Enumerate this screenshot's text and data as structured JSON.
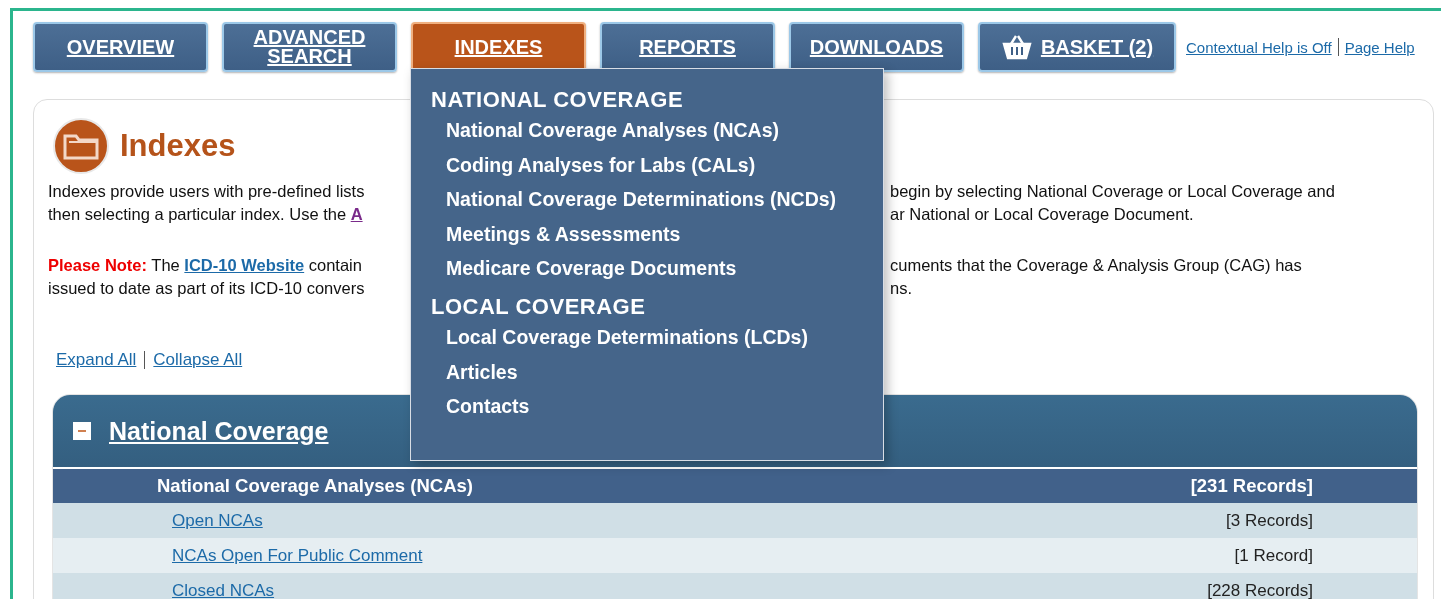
{
  "nav": {
    "tabs": [
      {
        "label": "OVERVIEW",
        "selected": false,
        "kind": "text"
      },
      {
        "label": "ADVANCED SEARCH",
        "selected": false,
        "kind": "text"
      },
      {
        "label": "INDEXES",
        "selected": true,
        "kind": "text"
      },
      {
        "label": "REPORTS",
        "selected": false,
        "kind": "text"
      },
      {
        "label": "DOWNLOADS",
        "selected": false,
        "kind": "text"
      },
      {
        "label": "BASKET (2)",
        "selected": false,
        "kind": "basket"
      }
    ],
    "help_links": [
      "Contextual Help is Off",
      "Page Help"
    ]
  },
  "dropdown": {
    "groups": [
      {
        "heading": "NATIONAL COVERAGE",
        "items": [
          "National Coverage Analyses (NCAs)",
          "Coding Analyses for Labs (CALs)",
          "National Coverage Determinations (NCDs)",
          "Meetings & Assessments",
          "Medicare Coverage Documents"
        ]
      },
      {
        "heading": "LOCAL COVERAGE",
        "items": [
          "Local Coverage Determinations (LCDs)",
          "Articles",
          "Contacts"
        ]
      }
    ]
  },
  "page": {
    "title": "Indexes",
    "paragraphs": [
      {
        "lines": [
          {
            "segments": [
              {
                "kind": "plain",
                "text": "Indexes provide users with pre-defined lists"
              }
            ],
            "right": "begin by selecting National Coverage or Local Coverage and"
          },
          {
            "segments": [
              {
                "kind": "plain",
                "text": "then selecting a particular index. Use the "
              },
              {
                "kind": "visited-link",
                "text": "A"
              }
            ],
            "right": "ar National or Local Coverage Document."
          }
        ]
      },
      {
        "lines": [
          {
            "segments": [
              {
                "kind": "note-label",
                "text": "Please Note:"
              },
              {
                "kind": "plain",
                "text": " The "
              },
              {
                "kind": "link",
                "text": "ICD-10 Website"
              },
              {
                "kind": "plain",
                "text": " contain"
              }
            ],
            "right": "cuments that the Coverage & Analysis Group (CAG) has"
          },
          {
            "segments": [
              {
                "kind": "plain",
                "text": "issued to date as part of its ICD-10 convers"
              }
            ],
            "right": "ns."
          }
        ]
      }
    ],
    "toggle_links": [
      "Expand All",
      "Collapse All"
    ],
    "section": {
      "title": "National Coverage",
      "expanded": true,
      "group": {
        "heading": "National Coverage Analyses (NCAs)",
        "count": "[231 Records]",
        "rows": [
          {
            "label": "Open NCAs",
            "count": "[3 Records]"
          },
          {
            "label": "NCAs Open For Public Comment",
            "count": "[1 Record]"
          },
          {
            "label": "Closed NCAs",
            "count": "[228 Records]"
          }
        ]
      }
    }
  }
}
